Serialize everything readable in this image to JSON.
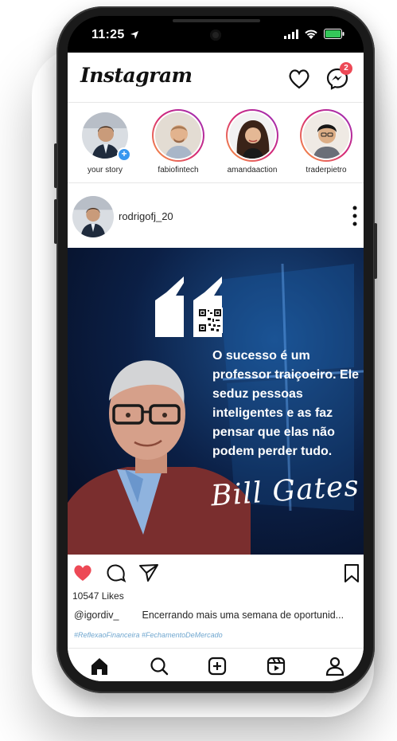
{
  "status_bar": {
    "time": "11:25"
  },
  "app": {
    "logo": "Instagram",
    "notification_count": "2"
  },
  "stories": [
    {
      "name": "your story"
    },
    {
      "name": "fabiofintech"
    },
    {
      "name": "amandaaction"
    },
    {
      "name": "traderpietro"
    }
  ],
  "post": {
    "username": "rodrigofj_20",
    "quote": "O sucesso é um professor traiçoeiro. Ele seduz pessoas inteligentes e as faz pensar que elas não podem perder tudo.",
    "signature": "Bill Gates",
    "likes": "10547 Likes",
    "caption_user": "@igordiv_",
    "caption_text": "Encerrando mais uma semana de oportunid...",
    "hashtags": "#ReflexaoFinanceira   #FechamentoDeMercado"
  },
  "colors": {
    "like_red": "#ed4956",
    "badge": "#ed4956",
    "hashtag": "#6fa6cf"
  },
  "icons": [
    "heart-icon",
    "messenger-icon",
    "comment-icon",
    "share-icon",
    "bookmark-icon",
    "home-icon",
    "search-icon",
    "add-post-icon",
    "reels-icon",
    "profile-icon"
  ]
}
